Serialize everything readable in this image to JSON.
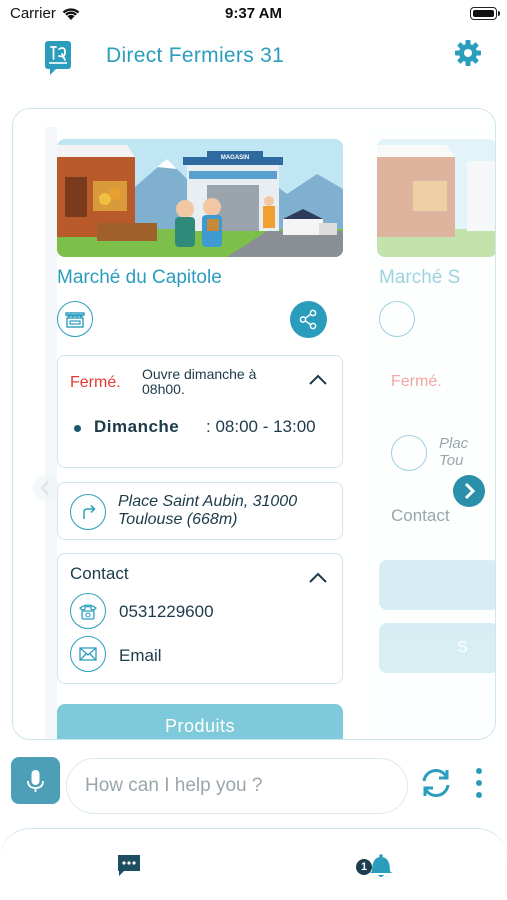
{
  "status_bar": {
    "carrier": "Carrier",
    "time": "9:37 AM"
  },
  "header": {
    "title": "Direct Fermiers 31",
    "logo_icon": "app-logo-icon",
    "settings_icon": "gear-icon"
  },
  "market": {
    "banner_sign": "MAGASIN",
    "name": "Marché du Capitole",
    "type_icon": "market-stall-icon",
    "share_icon": "share-icon",
    "hours": {
      "status": "Fermé.",
      "next_open": "Ouvre dimanche à 08h00.",
      "schedule": [
        {
          "day": "Dimanche",
          "hours": ": 08:00 - 13:00"
        }
      ]
    },
    "address": "Place Saint Aubin, 31000 Toulouse (668m)",
    "contact": {
      "title": "Contact",
      "phone": "0531229600",
      "email_label": "Email"
    },
    "products_button": "Produits"
  },
  "next_card": {
    "name": "Marché S",
    "status": "Fermé.",
    "address_preview": "Plac\nTou",
    "contact_title": "Contact",
    "button_fragment": "S"
  },
  "chat": {
    "placeholder": "How can I help you ?"
  },
  "bottom_nav": {
    "notification_count": "1"
  },
  "colors": {
    "accent": "#2a9dbd",
    "closed": "#e53935",
    "button": "#7ec9da",
    "dark": "#1c3a4a"
  }
}
